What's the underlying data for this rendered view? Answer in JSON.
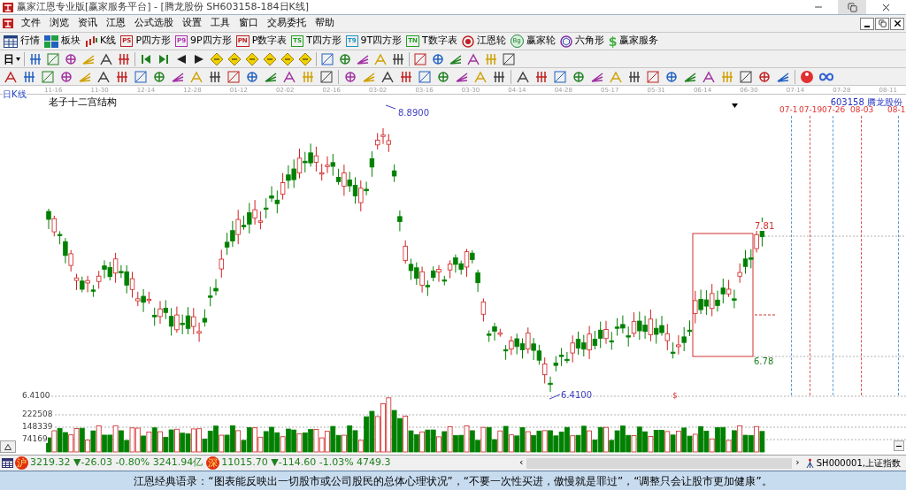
{
  "window": {
    "title": "赢家江恩专业版[赢家服务平台] - [腾龙股份  SH603158-184日K线]"
  },
  "menu": [
    "文件",
    "浏览",
    "资讯",
    "江恩",
    "公式选股",
    "设置",
    "工具",
    "窗口",
    "交易委托",
    "帮助"
  ],
  "toolbar": [
    {
      "kind": "grid",
      "label": "行情"
    },
    {
      "kind": "blocks",
      "label": "板块"
    },
    {
      "kind": "candles",
      "label": "K线"
    },
    {
      "kind": "badge",
      "badge": "PS",
      "label": "P四方形",
      "color": "#c02020"
    },
    {
      "kind": "badge",
      "badge": "P9",
      "label": "9P四方形",
      "color": "#b030b0"
    },
    {
      "kind": "badge",
      "badge": "PN",
      "label": "P数字表",
      "color": "#c02020"
    },
    {
      "kind": "badge",
      "badge": "TS",
      "label": "T四方形",
      "color": "#20a020"
    },
    {
      "kind": "badge",
      "badge": "T9",
      "label": "9T四方形",
      "color": "#2090c0"
    },
    {
      "kind": "badge",
      "badge": "TN",
      "label": "T数字表",
      "color": "#20a020"
    },
    {
      "kind": "target",
      "label": "江恩轮"
    },
    {
      "kind": "wheel",
      "badge": "Bg",
      "label": "赢家轮"
    },
    {
      "kind": "hexagon",
      "label": "六角形"
    },
    {
      "kind": "dollar",
      "badge": "$",
      "label": "赢家服务"
    }
  ],
  "period_selector": {
    "value": "日"
  },
  "chart": {
    "period_label": "日K线",
    "title": "老子十二宫结构",
    "dates": [
      "11-16",
      "11-30",
      "12-14",
      "12-28",
      "01-12",
      "02-02",
      "02-16",
      "03-02",
      "03-16",
      "03-30",
      "04-14",
      "04-28",
      "05-17",
      "05-31",
      "06-14",
      "06-30",
      "07-14",
      "07-28",
      "08-11"
    ],
    "symbol": "603158",
    "name": "腾龙股份",
    "high_label": "8.8900",
    "low_label": "6.4100",
    "box_top_label": "7.81",
    "box_bottom_label": "6.78",
    "marker": "$",
    "forecast_dates": [
      {
        "label": "07-1",
        "color": "#5b9bd5"
      },
      {
        "label": "07-19",
        "color": "#e05050"
      },
      {
        "label": "07-26",
        "color": "#5b9bd5"
      },
      {
        "label": "08-03",
        "color": "#e05050"
      },
      {
        "label": "08-1",
        "color": "#5b9bd5"
      }
    ]
  },
  "volume": {
    "price_label": "6.4100",
    "ticks": [
      "222508",
      "148339",
      "74169"
    ]
  },
  "status_bar": {
    "indices": [
      {
        "badge": "沪",
        "text": "3219.32 ▼-26.03 -0.80% 3241.94亿"
      },
      {
        "badge": "深",
        "text": "11015.70 ▼-114.60 -1.03% 4749.3"
      }
    ],
    "scroll_left": "‹",
    "scroll_right": "›",
    "index_label": "SH000001,上证指数"
  },
  "quote": "江恩经典语录：“图表能反映出一切股市或公司股民的总体心理状况”，“不要一次性买进，傲慢就是罪过”，“调整只会让股市更加健康”。"
}
